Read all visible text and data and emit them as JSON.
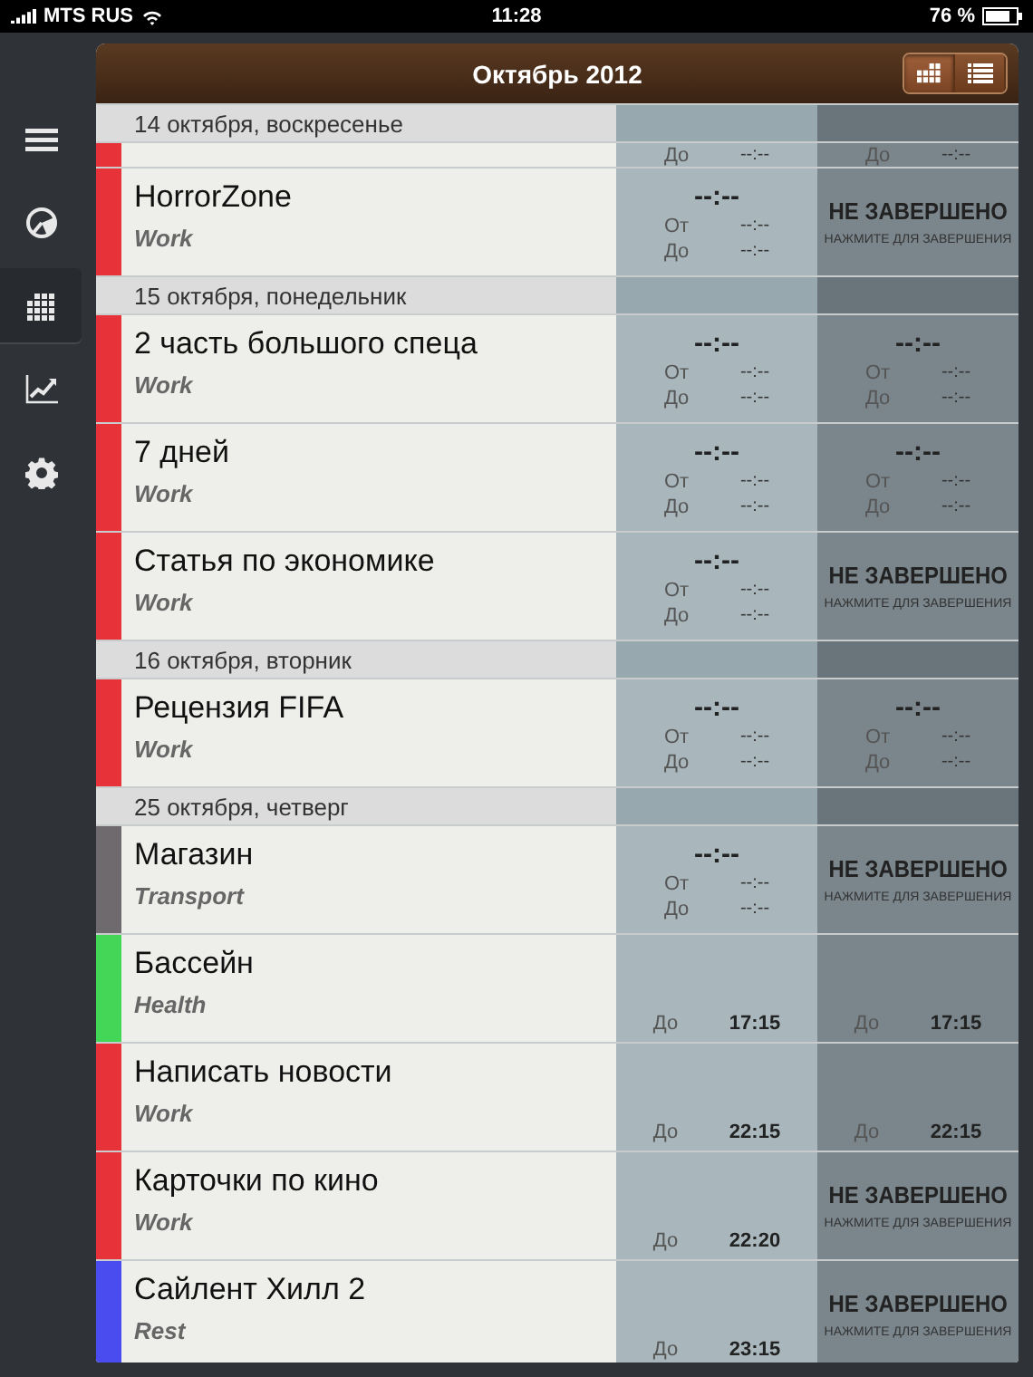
{
  "status_bar": {
    "carrier": "MTS RUS",
    "time": "11:28",
    "battery": "76 %"
  },
  "sidebar": {
    "items": [
      {
        "kind": "menu",
        "selected": false
      },
      {
        "kind": "pie",
        "selected": false
      },
      {
        "kind": "grid",
        "selected": true
      },
      {
        "kind": "chart",
        "selected": false
      },
      {
        "kind": "settings",
        "selected": false
      }
    ]
  },
  "header": {
    "title": "Октябрь 2012",
    "view_toggle": [
      {
        "kind": "grid",
        "selected": true
      },
      {
        "kind": "list",
        "selected": false
      }
    ]
  },
  "groups": [
    {
      "date": "14 октября, воскресенье",
      "clipped_row": {
        "color": "#e8323a",
        "col2": {
          "to_label": "До",
          "to": "--:--"
        },
        "col3": {
          "to_label": "До",
          "to": "--:--"
        }
      },
      "rows": [
        {
          "title": "HorrorZone",
          "category": "Work",
          "color": "#e8323a",
          "col2": {
            "kind": "times",
            "main": "--:--",
            "from_label": "От",
            "from": "--:--",
            "to_label": "До",
            "to": "--:--"
          },
          "col3": {
            "kind": "incomplete",
            "label": "НЕ ЗАВЕРШЕНО",
            "hint": "НАЖМИТЕ ДЛЯ ЗАВЕРШЕНИЯ"
          }
        }
      ]
    },
    {
      "date": "15 октября, понедельник",
      "rows": [
        {
          "title": "2 часть большого спеца",
          "category": "Work",
          "color": "#e8323a",
          "col2": {
            "kind": "times",
            "main": "--:--",
            "from_label": "От",
            "from": "--:--",
            "to_label": "До",
            "to": "--:--"
          },
          "col3": {
            "kind": "times",
            "main": "--:--",
            "from_label": "От",
            "from": "--:--",
            "to_label": "До",
            "to": "--:--"
          }
        },
        {
          "title": "7 дней",
          "category": "Work",
          "color": "#e8323a",
          "col2": {
            "kind": "times",
            "main": "--:--",
            "from_label": "От",
            "from": "--:--",
            "to_label": "До",
            "to": "--:--"
          },
          "col3": {
            "kind": "times",
            "main": "--:--",
            "from_label": "От",
            "from": "--:--",
            "to_label": "До",
            "to": "--:--"
          }
        },
        {
          "title": "Статья по экономике",
          "category": "Work",
          "color": "#e8323a",
          "col2": {
            "kind": "times",
            "main": "--:--",
            "from_label": "От",
            "from": "--:--",
            "to_label": "До",
            "to": "--:--"
          },
          "col3": {
            "kind": "incomplete",
            "label": "НЕ ЗАВЕРШЕНО",
            "hint": "НАЖМИТЕ ДЛЯ ЗАВЕРШЕНИЯ"
          }
        }
      ]
    },
    {
      "date": "16 октября, вторник",
      "rows": [
        {
          "title": "Рецензия FIFA",
          "category": "Work",
          "color": "#e8323a",
          "col2": {
            "kind": "times",
            "main": "--:--",
            "from_label": "От",
            "from": "--:--",
            "to_label": "До",
            "to": "--:--"
          },
          "col3": {
            "kind": "times",
            "main": "--:--",
            "from_label": "От",
            "from": "--:--",
            "to_label": "До",
            "to": "--:--"
          }
        }
      ]
    },
    {
      "date": "25 октября, четверг",
      "rows": [
        {
          "title": "Магазин",
          "category": "Transport",
          "color": "#6e6a6e",
          "col2": {
            "kind": "times",
            "main": "--:--",
            "from_label": "От",
            "from": "--:--",
            "to_label": "До",
            "to": "--:--"
          },
          "col3": {
            "kind": "incomplete",
            "label": "НЕ ЗАВЕРШЕНО",
            "hint": "НАЖМИТЕ ДЛЯ ЗАВЕРШЕНИЯ"
          }
        },
        {
          "title": "Бассейн",
          "category": "Health",
          "color": "#44d656",
          "col2": {
            "kind": "due",
            "to_label": "До",
            "to": "17:15"
          },
          "col3": {
            "kind": "due",
            "to_label": "До",
            "to": "17:15"
          }
        },
        {
          "title": "Написать новости",
          "category": "Work",
          "color": "#e8323a",
          "col2": {
            "kind": "due",
            "to_label": "До",
            "to": "22:15"
          },
          "col3": {
            "kind": "due",
            "to_label": "До",
            "to": "22:15"
          }
        },
        {
          "title": "Карточки по кино",
          "category": "Work",
          "color": "#e8323a",
          "col2": {
            "kind": "due",
            "to_label": "До",
            "to": "22:20"
          },
          "col3": {
            "kind": "incomplete",
            "label": "НЕ ЗАВЕРШЕНО",
            "hint": "НАЖМИТЕ ДЛЯ ЗАВЕРШЕНИЯ"
          }
        },
        {
          "title": "Сайлент Хилл 2",
          "category": "Rest",
          "color": "#4a4cf0",
          "col2": {
            "kind": "due",
            "to_label": "До",
            "to": "23:15"
          },
          "col3": {
            "kind": "incomplete",
            "label": "НЕ ЗАВЕРШЕНО",
            "hint": "НАЖМИТЕ ДЛЯ ЗАВЕРШЕНИЯ"
          }
        }
      ]
    }
  ]
}
